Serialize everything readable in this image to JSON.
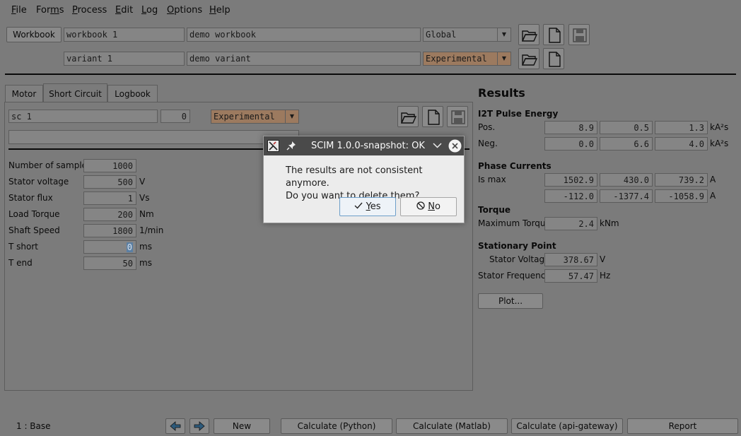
{
  "menu": [
    "File",
    "Forms",
    "Process",
    "Edit",
    "Log",
    "Options",
    "Help"
  ],
  "menu_mnemonic": [
    "F",
    "m",
    "P",
    "E",
    "L",
    "O",
    "H"
  ],
  "header": {
    "workbook_button": "Workbook",
    "workbook_name": "workbook 1",
    "workbook_desc": "demo workbook",
    "workbook_scope": "Global",
    "variant_name": "variant 1",
    "variant_desc": "demo variant",
    "variant_scope": "Experimental"
  },
  "tabs": [
    "Motor",
    "Short Circuit",
    "Logbook"
  ],
  "short_circuit": {
    "name": "sc 1",
    "index": "0",
    "scope": "Experimental",
    "comment": "",
    "params": [
      {
        "label": "Number of samples",
        "value": "1000",
        "unit": ""
      },
      {
        "label": "Stator voltage",
        "value": "500",
        "unit": "V"
      },
      {
        "label": "Stator flux",
        "value": "1",
        "unit": "Vs"
      },
      {
        "label": "Load Torque",
        "value": "200",
        "unit": "Nm"
      },
      {
        "label": "Shaft Speed",
        "value": "1800",
        "unit": "1/min"
      },
      {
        "label": "T short",
        "value": "0",
        "unit": "ms"
      },
      {
        "label": "T end",
        "value": "50",
        "unit": "ms"
      }
    ]
  },
  "results": {
    "title": "Results",
    "i2t_title": "I2T Pulse Energy",
    "pos_label": "Pos.",
    "pos_values": [
      "8.9",
      "0.5",
      "1.3"
    ],
    "pos_unit": "kA²s",
    "neg_label": "Neg.",
    "neg_values": [
      "0.0",
      "6.6",
      "4.0"
    ],
    "neg_unit": "kA²s",
    "phase_title": "Phase Currents",
    "ismax_label": "Is max",
    "ismax_row1": [
      "1502.9",
      "430.0",
      "739.2"
    ],
    "ismax_row2": [
      "-112.0",
      "-1377.4",
      "-1058.9"
    ],
    "current_unit": "A",
    "torque_title": "Torque",
    "max_torque_label": "Maximum Torque",
    "max_torque_value": "2.4",
    "max_torque_unit": "kNm",
    "stationary_title": "Stationary Point",
    "stator_voltage_label": "Stator Voltage",
    "stator_voltage_value": "378.67",
    "stator_voltage_unit": "V",
    "stator_freq_label": "Stator Frequency",
    "stator_freq_value": "57.47",
    "stator_freq_unit": "Hz",
    "plot_button": "Plot..."
  },
  "footer": {
    "status": "1 : Base",
    "new_button": "New",
    "calc_python": "Calculate (Python)",
    "calc_matlab": "Calculate (Matlab)",
    "calc_api": "Calculate (api-gateway)",
    "report": "Report"
  },
  "dialog": {
    "title": "SCIM 1.0.0-snapshot: OK",
    "line1": "The results are not consistent anymore.",
    "line2": "Do you want to delete them?",
    "yes_label": "Yes",
    "no_label": "No"
  },
  "colors": {
    "experimental": "#9c7a5f",
    "dialog_title": "#4a4a4a",
    "dimmed_background": "#7b7b7b"
  }
}
